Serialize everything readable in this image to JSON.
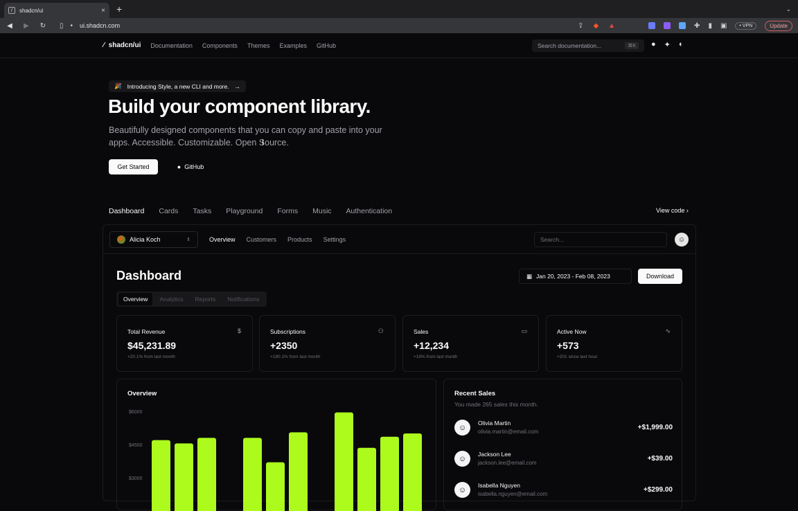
{
  "browser": {
    "tab_title": "shadcn/ui",
    "url": "ui.shadcn.com",
    "vpn": "• VPN",
    "update": "Update"
  },
  "header": {
    "brand": "shadcn/ui",
    "nav": [
      "Documentation",
      "Components",
      "Themes",
      "Examples",
      "GitHub"
    ],
    "search_placeholder": "Search documentation...",
    "shortcut": "⌘K"
  },
  "hero": {
    "announcement": "Introducing Style, a new CLI and more.",
    "title": "Build your component library.",
    "subtitle": "Beautifully designed components that you can copy and paste into your apps. Accessible. Customizable. Open Source.",
    "get_started": "Get Started",
    "github": "GitHub"
  },
  "examples": {
    "tabs": [
      "Dashboard",
      "Cards",
      "Tasks",
      "Playground",
      "Forms",
      "Music",
      "Authentication"
    ],
    "view_code": "View code"
  },
  "demo": {
    "team": "Alicia Koch",
    "nav": [
      "Overview",
      "Customers",
      "Products",
      "Settings"
    ],
    "search_placeholder": "Search...",
    "title": "Dashboard",
    "date_range": "Jan 20, 2023 - Feb 08, 2023",
    "download": "Download",
    "tabs": [
      "Overview",
      "Analytics",
      "Reports",
      "Notifications"
    ],
    "stats": [
      {
        "label": "Total Revenue",
        "value": "$45,231.89",
        "note": "+20.1% from last month",
        "icon": "dollar-icon"
      },
      {
        "label": "Subscriptions",
        "value": "+2350",
        "note": "+180.1% from last month",
        "icon": "users-icon"
      },
      {
        "label": "Sales",
        "value": "+12,234",
        "note": "+19% from last month",
        "icon": "credit-card-icon"
      },
      {
        "label": "Active Now",
        "value": "+573",
        "note": "+201 since last hour",
        "icon": "activity-icon"
      }
    ],
    "overview_title": "Overview",
    "recent_sales_title": "Recent Sales",
    "recent_sales_sub": "You made 265 sales this month.",
    "sales": [
      {
        "name": "Olivia Martin",
        "email": "olivia.martin@email.com",
        "amount": "+$1,999.00"
      },
      {
        "name": "Jackson Lee",
        "email": "jackson.lee@email.com",
        "amount": "+$39.00"
      },
      {
        "name": "Isabella Nguyen",
        "email": "isabella.nguyen@email.com",
        "amount": "+$299.00"
      }
    ]
  },
  "chart_data": {
    "type": "bar",
    "title": "Overview",
    "y_ticks": [
      "$6000",
      "$4500",
      "$3000"
    ],
    "ylim": [
      0,
      6000
    ],
    "values": [
      4700,
      4550,
      4800,
      null,
      4800,
      3700,
      5050,
      null,
      5950,
      4350,
      4850,
      5000
    ],
    "color": "#adfa1d"
  }
}
